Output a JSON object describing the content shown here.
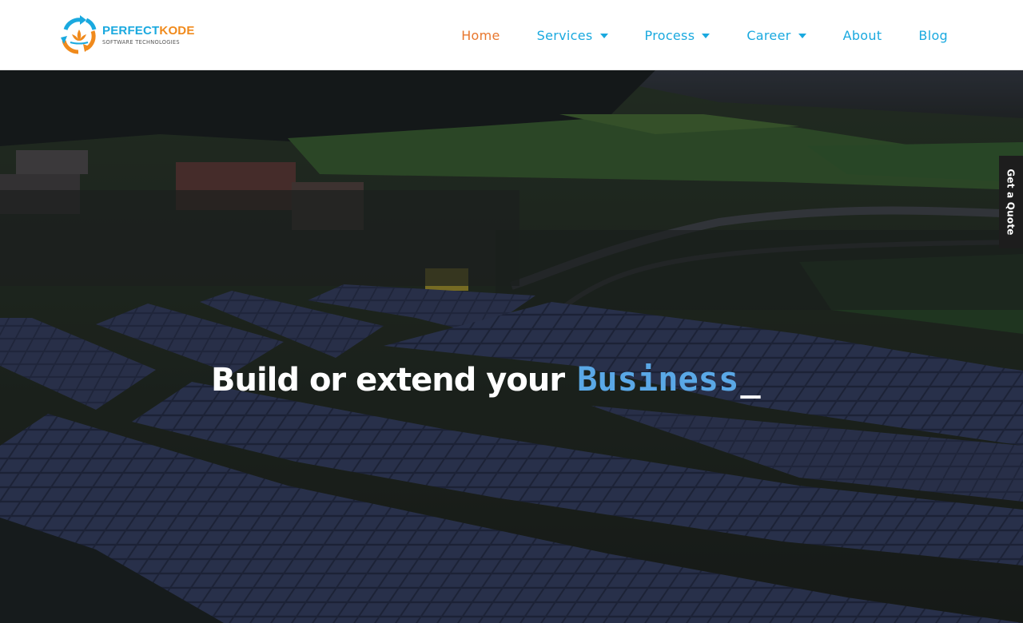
{
  "brand": {
    "name_part1": "PERFECT",
    "name_part2": "KODE",
    "tagline": "SOFTWARE TECHNOLOGIES",
    "logo_icon": "lotus-arrows-logo",
    "colors": {
      "blue": "#1aa9df",
      "orange": "#f08a1c"
    }
  },
  "nav": {
    "items": [
      {
        "label": "Home",
        "active": true,
        "has_dropdown": false
      },
      {
        "label": "Services",
        "active": false,
        "has_dropdown": true
      },
      {
        "label": "Process",
        "active": false,
        "has_dropdown": true
      },
      {
        "label": "Career",
        "active": false,
        "has_dropdown": true
      },
      {
        "label": "About",
        "active": false,
        "has_dropdown": false
      },
      {
        "label": "Blog",
        "active": false,
        "has_dropdown": false
      }
    ],
    "active_color": "#e8772e",
    "link_color": "#1aa9df",
    "dropdown_icon": "caret-down-icon"
  },
  "hero": {
    "background": "aerial-solar-farm-photo",
    "headline_static": "Build or extend your",
    "headline_typed": "Business",
    "cursor": "_",
    "typed_color": "#5aa8e6"
  },
  "quote_tab": {
    "label": "Get a Quote"
  }
}
